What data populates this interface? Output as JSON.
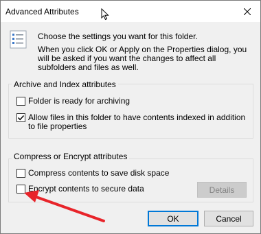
{
  "window": {
    "title": "Advanced Attributes"
  },
  "header": {
    "line1": "Choose the settings you want for this folder.",
    "line2": "When you click OK or Apply on the Properties dialog, you will be asked if you want the changes to affect all subfolders and files as well."
  },
  "archive_group": {
    "label": "Archive and Index attributes",
    "items": [
      {
        "label": "Folder is ready for archiving",
        "checked": false
      },
      {
        "label": "Allow files in this folder to have contents indexed in addition to file properties",
        "checked": true
      }
    ]
  },
  "compress_group": {
    "label": "Compress or Encrypt attributes",
    "items": [
      {
        "label": "Compress contents to save disk space",
        "checked": false
      },
      {
        "label": "Encrypt contents to secure data",
        "checked": false
      }
    ],
    "details_label": "Details"
  },
  "buttons": {
    "ok": "OK",
    "cancel": "Cancel"
  },
  "annotation": {
    "arrow_color": "#e8242a"
  }
}
